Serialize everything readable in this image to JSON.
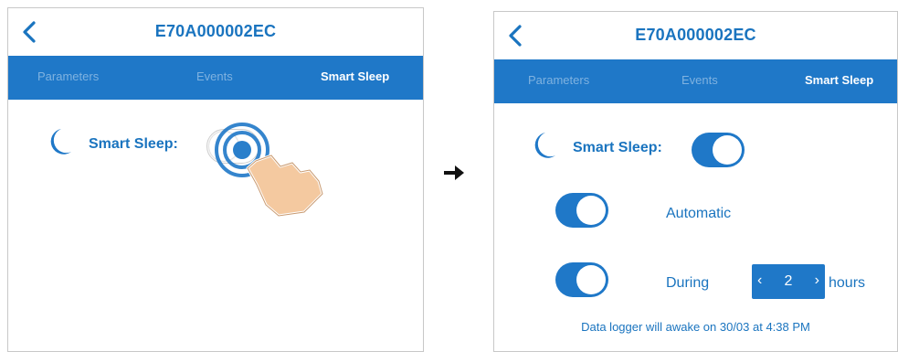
{
  "left_screen": {
    "device_id": "E70A000002EC",
    "tabs": [
      {
        "label": "Parameters"
      },
      {
        "label": "Events"
      },
      {
        "label": "Smart Sleep"
      }
    ],
    "smart_sleep_label": "Smart Sleep:",
    "smart_sleep_toggle": "off"
  },
  "right_screen": {
    "device_id": "E70A000002EC",
    "tabs": [
      {
        "label": "Parameters"
      },
      {
        "label": "Events"
      },
      {
        "label": "Smart Sleep"
      }
    ],
    "smart_sleep_label": "Smart Sleep:",
    "smart_sleep_toggle": "on",
    "automatic_label": "Automatic",
    "automatic_toggle": "on",
    "during_label": "During",
    "during_toggle": "on",
    "hours_value": "2",
    "hours_unit": "hours",
    "status_note": "Data logger will awake on 30/03 at 4:38 PM"
  },
  "icons": {
    "back": "chevron-left-icon",
    "moon": "moon-icon",
    "arrow": "right-arrow-icon",
    "tap_hand": "hand-tap-icon"
  },
  "colors": {
    "accent": "#1f78c8",
    "title_text": "#1a74bf",
    "inactive_tab_text": "#7fb2e0",
    "toggle_off": "#ffffff"
  }
}
